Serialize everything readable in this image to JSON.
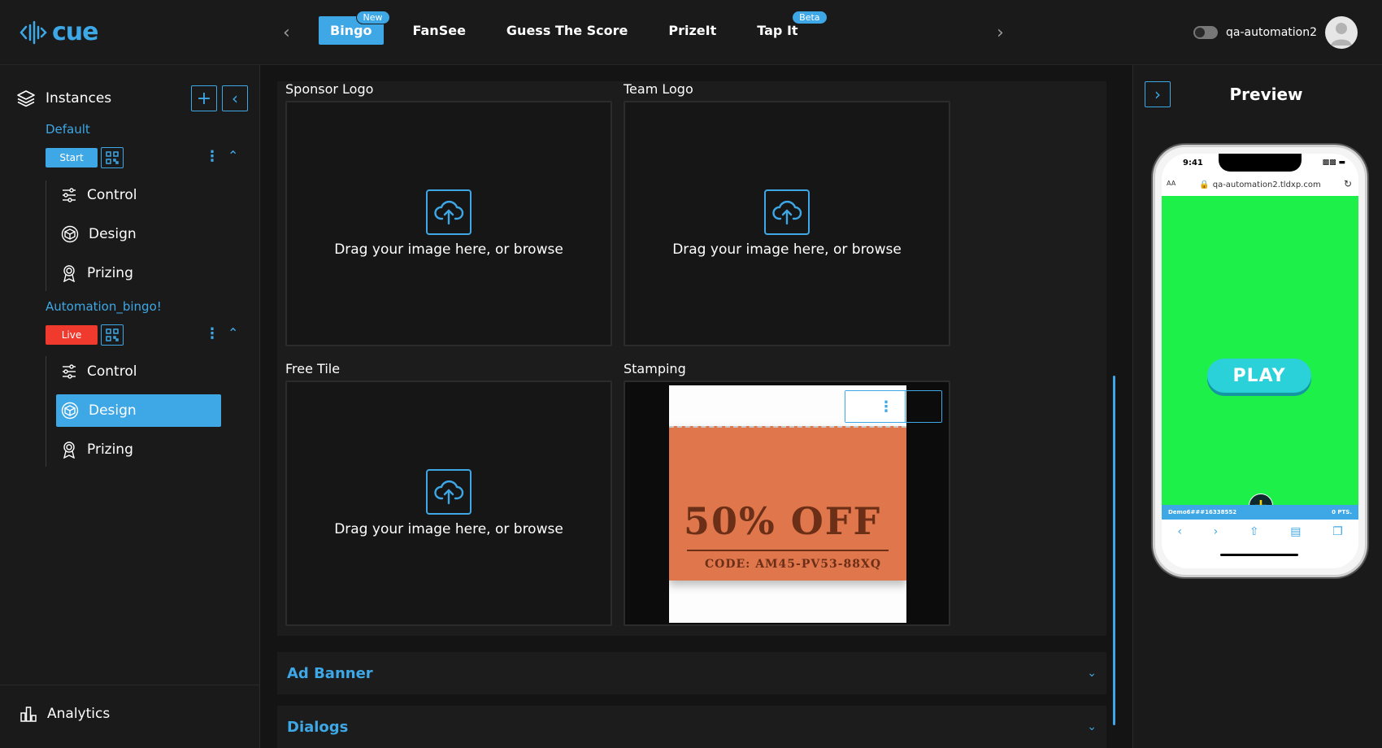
{
  "app": {
    "logo_text": "cue"
  },
  "tabs": [
    {
      "label": "Bingo",
      "badge": "New",
      "active": true
    },
    {
      "label": "FanSee",
      "badge": ""
    },
    {
      "label": "Guess The Score",
      "badge": ""
    },
    {
      "label": "PrizeIt",
      "badge": ""
    },
    {
      "label": "Tap It",
      "badge": "Beta"
    }
  ],
  "user": {
    "name": "qa-automation2"
  },
  "sidebar": {
    "title": "Instances",
    "instances": [
      {
        "name": "Default",
        "status": "Start",
        "status_color": "#3ea7e6",
        "items": [
          "Control",
          "Design",
          "Prizing"
        ]
      },
      {
        "name": "Automation_bingo!",
        "status": "Live",
        "status_color": "#f03a2e",
        "items": [
          "Control",
          "Design",
          "Prizing"
        ],
        "active_item": "Design"
      }
    ],
    "analytics_label": "Analytics"
  },
  "main": {
    "fields": [
      {
        "label": "Sponsor Logo",
        "prompt": "Drag your image here, or browse"
      },
      {
        "label": "Team Logo",
        "prompt": "Drag your image here, or browse"
      },
      {
        "label": "Free Tile",
        "prompt": "Drag your image here, or browse"
      },
      {
        "label": "Stamping"
      }
    ],
    "stamp_image": {
      "headline": "50% OFF",
      "code": "CODE: AM45-PV53-88XQ"
    },
    "accordions": [
      "Ad Banner",
      "Dialogs"
    ]
  },
  "preview": {
    "title": "Preview",
    "phone": {
      "time": "9:41",
      "aa": "AA",
      "url": "qa-automation2.tldxp.com",
      "play_label": "PLAY",
      "footer_id": "Demo6###16338552",
      "footer_pts": "0 PTS."
    }
  },
  "colors": {
    "accent": "#3ea7e6",
    "live": "#f03a2e",
    "phone_bg": "#1ef04a",
    "play": "#2ad1d9"
  }
}
